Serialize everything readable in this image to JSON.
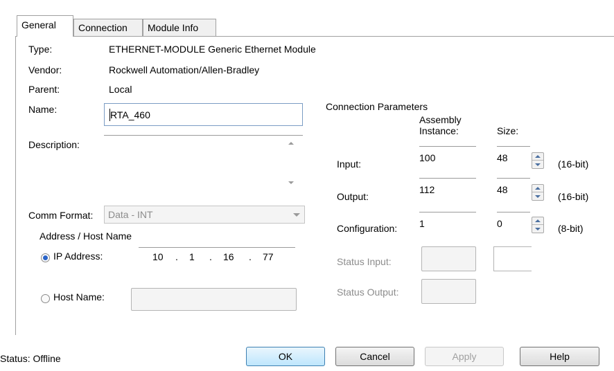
{
  "tabs": [
    {
      "label": "General",
      "active": true
    },
    {
      "label": "Connection",
      "active": false
    },
    {
      "label": "Module Info",
      "active": false
    }
  ],
  "general": {
    "type_label": "Type:",
    "type_value": "ETHERNET-MODULE Generic Ethernet Module",
    "vendor_label": "Vendor:",
    "vendor_value": "Rockwell Automation/Allen-Bradley",
    "parent_label": "Parent:",
    "parent_value": "Local",
    "name_label": "Name:",
    "name_value": "RTA_460",
    "description_label": "Description:",
    "description_value": "",
    "comm_format_label": "Comm Format:",
    "comm_format_value": "Data - INT",
    "address_group_label": "Address / Host Name",
    "ip_address_label": "IP Address:",
    "ip_octets": [
      "10",
      "1",
      "16",
      "77"
    ],
    "ip_dot": ".",
    "host_name_label": "Host Name:",
    "host_name_value": ""
  },
  "connection_parameters": {
    "title": "Connection Parameters",
    "assembly_header_line1": "Assembly",
    "assembly_header_line2": "Instance:",
    "size_header": "Size:",
    "rows": [
      {
        "label": "Input:",
        "instance": "100",
        "size": "48",
        "unit": "(16-bit)"
      },
      {
        "label": "Output:",
        "instance": "112",
        "size": "48",
        "unit": "(16-bit)"
      },
      {
        "label": "Configuration:",
        "instance": "1",
        "size": "0",
        "unit": "(8-bit)"
      }
    ],
    "status_input_label": "Status Input:",
    "status_output_label": "Status Output:"
  },
  "footer": {
    "status_text": "Status:  Offline",
    "ok_label": "OK",
    "cancel_label": "Cancel",
    "apply_label": "Apply",
    "help_label": "Help"
  },
  "colors": {
    "accent_blue": "#3c7fb1",
    "radio_selected": "#2a64c8",
    "disabled_text": "#8c8c8c"
  },
  "icons": [
    "spin-up-icon",
    "spin-down-icon",
    "scroll-up-icon",
    "scroll-down-icon",
    "dropdown-arrow-icon"
  ]
}
